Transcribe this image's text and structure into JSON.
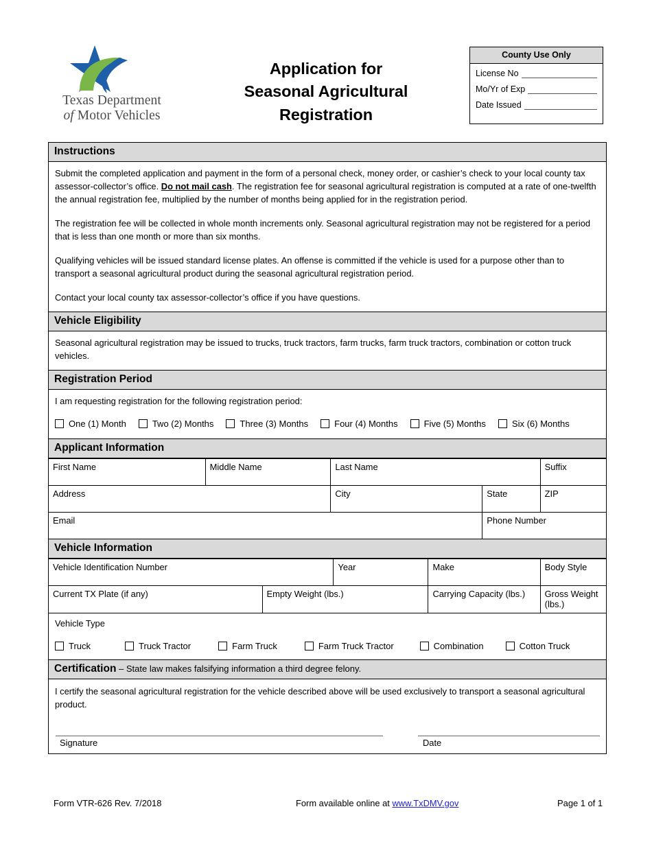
{
  "header": {
    "logo": {
      "icon": "txdmv-star-logo",
      "line1": "Texas Department",
      "line2_prefix": "of ",
      "line2": "Motor Vehicles",
      "colors": {
        "blue": "#1f5fa9",
        "green": "#7ab648"
      }
    },
    "title_line1": "Application for",
    "title_line2": "Seasonal Agricultural",
    "title_line3": "Registration",
    "county_box": {
      "heading": "County Use Only",
      "rows": [
        {
          "label": "License No"
        },
        {
          "label": "Mo/Yr of Exp"
        },
        {
          "label": "Date Issued"
        }
      ]
    }
  },
  "sections": {
    "instructions": {
      "heading": "Instructions",
      "paragraphs": [
        {
          "before": "Submit the completed application and payment in the form of a personal check, money order, or cashier’s check to your local county tax assessor-collector’s office. ",
          "emphasis": "Do not mail cash",
          "after": ". The registration fee for seasonal agricultural registration is computed at a rate of one-twelfth the annual registration fee, multiplied by the number of months being applied for in the registration period."
        },
        {
          "text": "The registration fee will be collected in whole month increments only.  Seasonal agricultural registration may not be registered for a period that is less than one month or more than six months."
        },
        {
          "text": "Qualifying vehicles will be issued standard license plates. An offense is committed if the vehicle is used for a purpose other than to transport a seasonal agricultural product during the seasonal agricultural registration period."
        },
        {
          "text": "Contact your local county tax assessor-collector’s office if you have questions."
        }
      ]
    },
    "vehicle_eligibility": {
      "heading": "Vehicle Eligibility",
      "text": "Seasonal agricultural registration may be issued to trucks, truck tractors, farm trucks, farm truck tractors, combination or cotton truck vehicles."
    },
    "registration_period": {
      "heading": "Registration Period",
      "prompt": "I am requesting registration for the following registration period:",
      "options": [
        "One (1) Month",
        "Two (2) Months",
        "Three (3) Months",
        "Four (4) Months",
        "Five (5) Months",
        "Six (6) Months"
      ]
    },
    "applicant_information": {
      "heading": "Applicant Information",
      "row1": [
        "First Name",
        "Middle Name",
        "Last Name",
        "Suffix"
      ],
      "row2": [
        "Address",
        "City",
        "State",
        "ZIP"
      ],
      "row3": [
        "Email",
        "Phone Number"
      ]
    },
    "vehicle_information": {
      "heading": "Vehicle Information",
      "row1": [
        "Vehicle Identification Number",
        "Year",
        "Make",
        "Body Style"
      ],
      "row2": [
        "Current TX Plate (if any)",
        "Empty Weight (lbs.)",
        "Carrying Capacity (lbs.)",
        "Gross Weight (lbs.)"
      ],
      "vehicle_type_label": "Vehicle Type",
      "vehicle_types": [
        "Truck",
        "Truck Tractor",
        "Farm Truck",
        "Farm Truck Tractor",
        "Combination",
        "Cotton Truck"
      ]
    },
    "certification": {
      "heading_bold": "Certification",
      "heading_rest": " – State law makes falsifying information a third degree felony.",
      "text": "I certify the seasonal agricultural registration for the vehicle described above will be used exclusively to transport a seasonal agricultural product.",
      "signature_label": "Signature",
      "date_label": "Date"
    }
  },
  "footer": {
    "form_id": "Form VTR-626 Rev. 7/2018",
    "availability_prefix": "Form available online at ",
    "link": "www.TxDMV.gov",
    "page": "Page 1 of 1"
  }
}
